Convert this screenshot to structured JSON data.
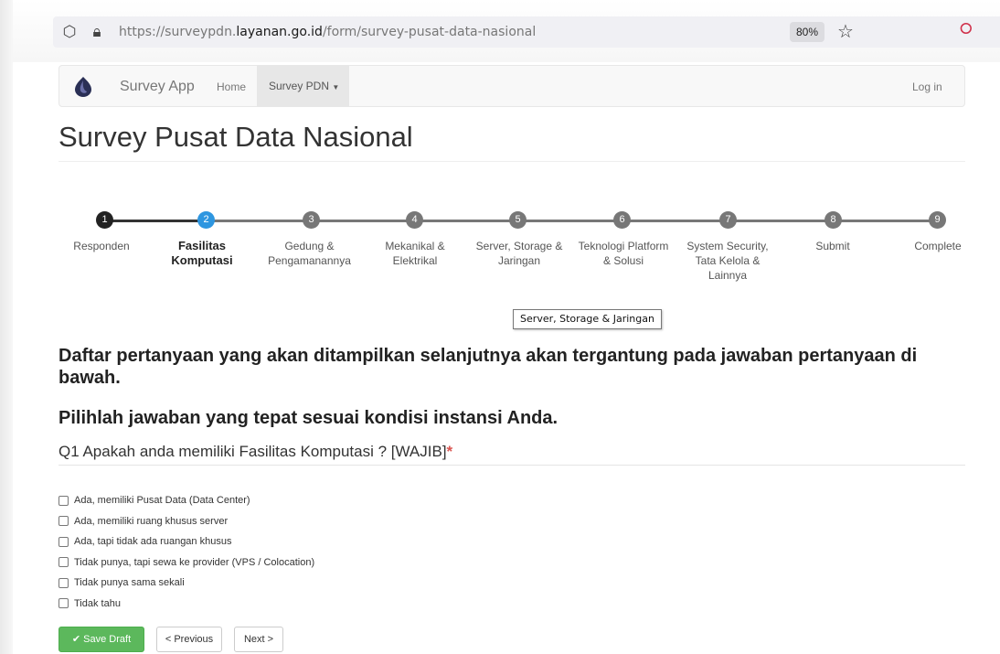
{
  "browser": {
    "url_prefix": "https://surveypdn.",
    "url_domain": "layanan.go.id",
    "url_path": "/form/survey-pusat-data-nasional",
    "zoom": "80%"
  },
  "navbar": {
    "brand": "Survey App",
    "home": "Home",
    "survey_menu": "Survey PDN",
    "login": "Log in"
  },
  "page_title": "Survey Pusat Data Nasional",
  "wizard": {
    "steps": [
      {
        "num": "1",
        "label": "Responden"
      },
      {
        "num": "2",
        "label": "Fasilitas Komputasi"
      },
      {
        "num": "3",
        "label": "Gedung & Pengamanannya"
      },
      {
        "num": "4",
        "label": "Mekanikal & Elektrikal"
      },
      {
        "num": "5",
        "label": "Server, Storage & Jaringan"
      },
      {
        "num": "6",
        "label": "Teknologi Platform & Solusi"
      },
      {
        "num": "7",
        "label": "System Security, Tata Kelola & Lainnya"
      },
      {
        "num": "8",
        "label": "Submit"
      },
      {
        "num": "9",
        "label": "Complete"
      }
    ],
    "active_step": 2
  },
  "tooltip": "Server, Storage & Jaringan",
  "intro": "Daftar pertanyaan yang akan ditampilkan selanjutnya akan tergantung pada jawaban pertanyaan di bawah.",
  "instruction": "Pilihlah jawaban yang tepat sesuai kondisi instansi Anda.",
  "question": {
    "text": "Q1 Apakah anda memiliki Fasilitas Komputasi ? [WAJIB]",
    "required_mark": "*"
  },
  "options": [
    "Ada, memiliki Pusat Data (Data Center)",
    "Ada, memiliki ruang khusus server",
    "Ada, tapi tidak ada ruangan khusus",
    "Tidak punya, tapi sewa ke provider (VPS / Colocation)",
    "Tidak punya sama sekali",
    "Tidak tahu"
  ],
  "buttons": {
    "save": "Save Draft",
    "previous": "< Previous",
    "next": "Next >"
  },
  "colors": {
    "active_step": "#2e96e0",
    "done_step": "#222222",
    "pending_step": "#777777",
    "save_button": "#5cb85c",
    "required": "#d9534f"
  }
}
